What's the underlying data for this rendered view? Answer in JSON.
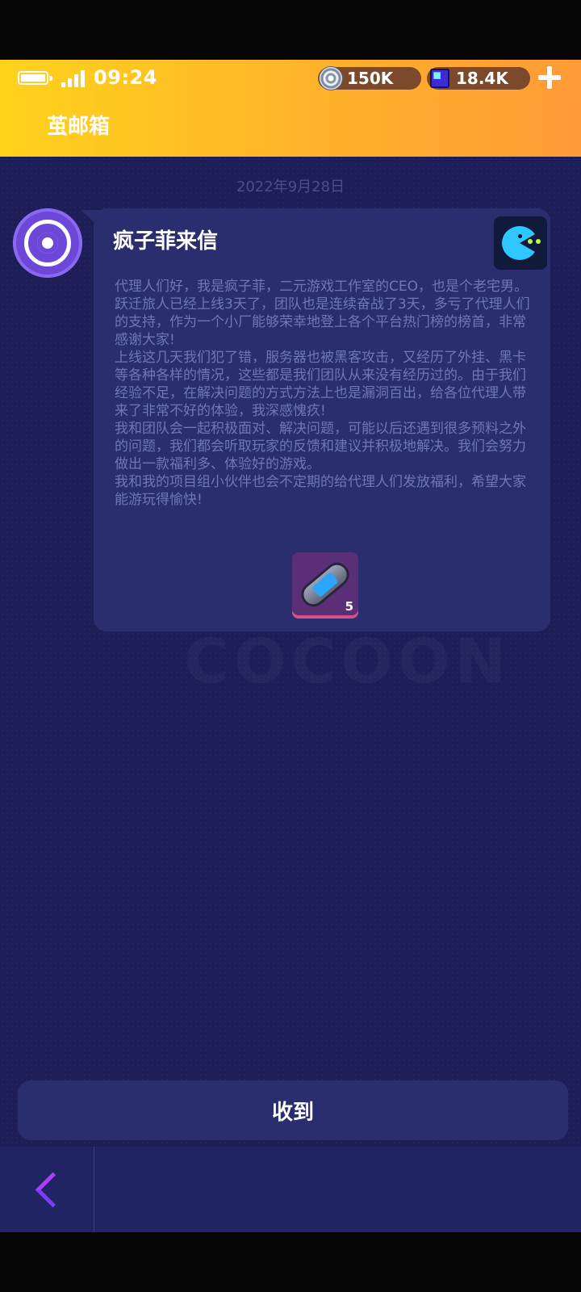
{
  "status_bar": {
    "time": "09:24"
  },
  "currencies": {
    "coins": "150K",
    "gems": "18.4K"
  },
  "header": {
    "title": "茧邮箱"
  },
  "watermark": "COCOON",
  "message": {
    "date": "2022年9月28日",
    "sender_title": "疯子菲来信",
    "body": "代理人们好，我是疯子菲，二元游戏工作室的CEO，也是个老宅男。\n跃迁旅人已经上线3天了，团队也是连续奋战了3天，多亏了代理人们的支持，作为一个小厂能够荣幸地登上各个平台热门榜的榜首，非常感谢大家!\n上线这几天我们犯了错，服务器也被黑客攻击，又经历了外挂、黑卡等各种各样的情况，这些都是我们团队从来没有经历过的。由于我们经验不足，在解决问题的方式方法上也是漏洞百出，给各位代理人带来了非常不好的体验，我深感愧疚!\n我和团队会一起积极面对、解决问题，可能以后还遇到很多预料之外的问题，我们都会听取玩家的反馈和建议并积极地解决。我们会努力做出一款福利多、体验好的游戏。\n我和我的项目组小伙伴也会不定期的给代理人们发放福利，希望大家能游玩得愉快!",
    "attachment": {
      "icon": "capsule-item-icon",
      "quantity": "5"
    }
  },
  "actions": {
    "receive_label": "收到"
  },
  "colors": {
    "header_start": "#ffd21c",
    "header_end": "#ff9a36",
    "background": "#1d1e57",
    "card": "#2a2e6e",
    "body_text": "#6f76b8"
  }
}
